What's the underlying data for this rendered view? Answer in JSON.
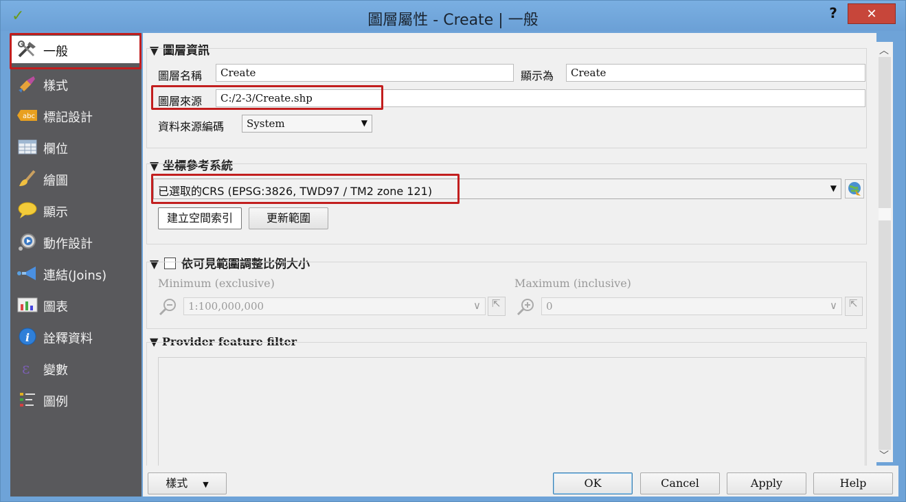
{
  "window": {
    "title": "圖層屬性 - Create | 一般",
    "help_label": "?",
    "close_label": "✕"
  },
  "sidebar": {
    "items": [
      {
        "label": "一般",
        "icon": "tools-icon"
      },
      {
        "label": "樣式",
        "icon": "brush-icon"
      },
      {
        "label": "標記設計",
        "icon": "abc-label-icon"
      },
      {
        "label": "欄位",
        "icon": "table-icon"
      },
      {
        "label": "繪圖",
        "icon": "paintbrush-icon"
      },
      {
        "label": "顯示",
        "icon": "speech-bubble-icon"
      },
      {
        "label": "動作設計",
        "icon": "action-gear-icon"
      },
      {
        "label": "連結(Joins)",
        "icon": "join-icon"
      },
      {
        "label": "圖表",
        "icon": "chart-icon"
      },
      {
        "label": "詮釋資料",
        "icon": "info-icon"
      },
      {
        "label": "變數",
        "icon": "variable-icon"
      },
      {
        "label": "圖例",
        "icon": "legend-icon"
      }
    ]
  },
  "layer_info": {
    "title": "圖層資訊",
    "name_label": "圖層名稱",
    "name_value": "Create",
    "display_label": "顯示為",
    "display_value": "Create",
    "source_label": "圖層來源",
    "source_value": "C:/2-3/Create.shp",
    "encoding_label": "資料來源編碼",
    "encoding_value": "System"
  },
  "crs": {
    "title": "坐標參考系統",
    "selected": "已選取的CRS (EPSG:3826, TWD97 / TM2 zone 121)",
    "spatial_index_button": "建立空間索引",
    "update_extent_button": "更新範圍"
  },
  "scale": {
    "title": "依可見範圍調整比例大小",
    "checked": false,
    "min_label": "Minimum (exclusive)",
    "min_value": "1:100,000,000",
    "max_label": "Maximum (inclusive)",
    "max_value": "0"
  },
  "provider_filter": {
    "title": "Provider feature filter"
  },
  "footer": {
    "style_button": "樣式",
    "ok": "OK",
    "cancel": "Cancel",
    "apply": "Apply",
    "help": "Help"
  },
  "colors": {
    "titlebar": "#6ea3d8",
    "sidebar": "#59595c",
    "highlight_box": "#c21e1e",
    "close_button": "#c7463a"
  }
}
